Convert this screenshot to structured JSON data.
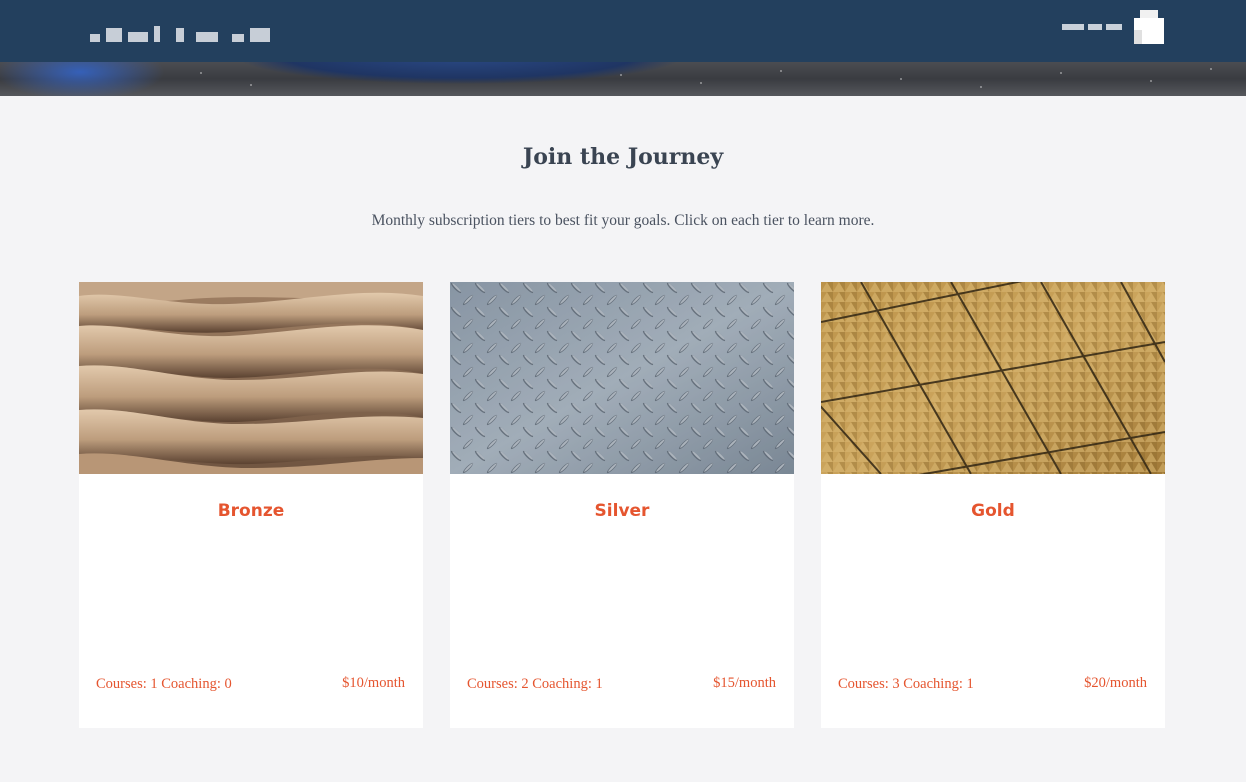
{
  "header": {
    "brand_icon": "blurred-logo-text",
    "user_icon": "user-avatar-icon"
  },
  "section": {
    "title": "Join the Journey",
    "subtitle": "Monthly subscription tiers to best fit your goals. Click on each tier to learn more."
  },
  "tiers": [
    {
      "name": "Bronze",
      "features": "Courses: 1 Coaching: 0",
      "price": "$10/month",
      "image": "sand-dunes-texture"
    },
    {
      "name": "Silver",
      "features": "Courses: 2 Coaching: 1",
      "price": "$15/month",
      "image": "diamond-plate-metal-texture"
    },
    {
      "name": "Gold",
      "features": "Courses: 3 Coaching: 1",
      "price": "$20/month",
      "image": "gold-triangle-tile-texture"
    }
  ],
  "colors": {
    "nav_bg": "#23405e",
    "accent": "#e5552f",
    "page_bg": "#f4f4f6",
    "heading": "#3a4452"
  }
}
